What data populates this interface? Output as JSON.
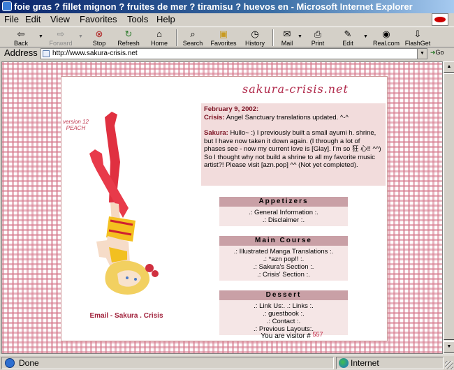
{
  "window": {
    "title": "foie gras ? fillet mignon ? fruites de mer ? tiramisu ? huevos en - Microsoft Internet Explorer"
  },
  "menu": [
    "File",
    "Edit",
    "View",
    "Favorites",
    "Tools",
    "Help"
  ],
  "toolbar": {
    "back": "Back",
    "forward": "Forward",
    "stop": "Stop",
    "refresh": "Refresh",
    "home": "Home",
    "search": "Search",
    "favorites": "Favorites",
    "history": "History",
    "mail": "Mail",
    "print": "Print",
    "edit": "Edit",
    "realcom": "Real.com",
    "flashget": "FlashGet"
  },
  "address": {
    "label": "Address",
    "url": "http://www.sakura-crisis.net",
    "go": "Go"
  },
  "page": {
    "site_title": "sakura-crisis.net",
    "version_label": "version 12",
    "version_name": "PEACH",
    "email_line": "Email - Sakura . Crisis",
    "news": {
      "date": "February 9, 2002:",
      "line1_name": "Crisis:",
      "line1_text": " Angel Sanctuary translations updated. ^-^",
      "line2_name": "Sakura:",
      "line2_text": " Hullo~ :) I previously built a small ayumi h. shrine, but I have now taken it down again. (I through a lot of phases see - now my current love is [Glay]. I'm so 狂 心!! ^^) So I thought why not build a shrine to all my favorite music artist?! Please visit [azn.pop] ^^ (Not yet completed)."
    },
    "sections": [
      {
        "title": "Appetizers",
        "links": [
          ".: General Information :.",
          ".: Disclaimer :."
        ]
      },
      {
        "title": "Main Course",
        "links": [
          ".: Illustrated Manga Translations :.",
          ".: *azn pop!! :.",
          ".: Sakura's Section :.",
          ".: Crisis' Section :."
        ]
      },
      {
        "title": "Dessert",
        "links": [
          ".: Link Us:. .: Links :.",
          ".: guestbook :.",
          ".: Contact :.",
          ".: Previous Layouts:."
        ]
      }
    ],
    "visitor_label": "You are visitor #",
    "visitor_count": "557"
  },
  "status": {
    "text": "Done",
    "zone": "Internet"
  }
}
